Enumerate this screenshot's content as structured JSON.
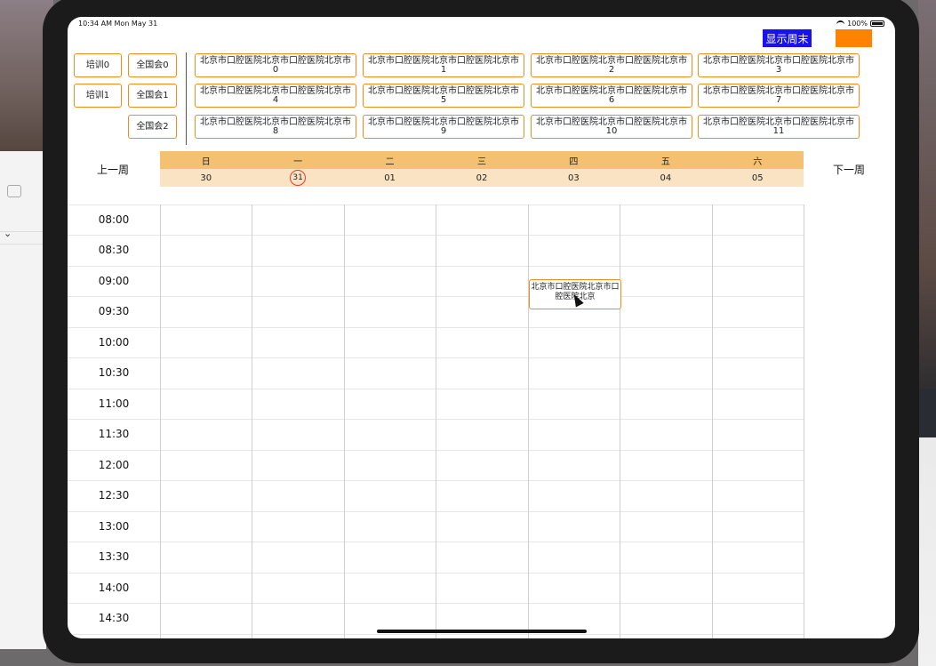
{
  "status_bar": {
    "time": "10:34 AM   Mon May 31",
    "battery": "100%"
  },
  "toolbar": {
    "show_weekend_label": "显示周末"
  },
  "left_tags": [
    "培训0",
    "培训1"
  ],
  "mid_tags": [
    "全国会0",
    "全国会1",
    "全国会2"
  ],
  "hospital_tags": [
    "北京市口腔医院北京市口腔医院北京市0",
    "北京市口腔医院北京市口腔医院北京市1",
    "北京市口腔医院北京市口腔医院北京市2",
    "北京市口腔医院北京市口腔医院北京市3",
    "北京市口腔医院北京市口腔医院北京市4",
    "北京市口腔医院北京市口腔医院北京市5",
    "北京市口腔医院北京市口腔医院北京市6",
    "北京市口腔医院北京市口腔医院北京市7",
    "北京市口腔医院北京市口腔医院北京市8",
    "北京市口腔医院北京市口腔医院北京市9",
    "北京市口腔医院北京市口腔医院北京市10",
    "北京市口腔医院北京市口腔医院北京市11"
  ],
  "nav": {
    "prev_week": "上一周",
    "next_week": "下一周"
  },
  "week": {
    "weekdays": [
      "日",
      "一",
      "二",
      "三",
      "四",
      "五",
      "六"
    ],
    "dates": [
      "30",
      "31",
      "01",
      "02",
      "03",
      "04",
      "05"
    ],
    "today_index": 1
  },
  "time_slots": [
    "08:00",
    "08:30",
    "09:00",
    "09:30",
    "10:00",
    "10:30",
    "11:00",
    "11:30",
    "12:00",
    "12:30",
    "13:00",
    "13:30",
    "14:00",
    "14:30"
  ],
  "event": {
    "text": "北京市口腔医院北京市口腔医院北京",
    "day": "四",
    "time": "09:00"
  },
  "colors": {
    "accent_orange": "#f08c1e",
    "weekday_bg": "#f3c171",
    "date_bg": "#fae3c3",
    "weekend_button": "#1a11f0",
    "today_ring": "#e53b2f"
  }
}
